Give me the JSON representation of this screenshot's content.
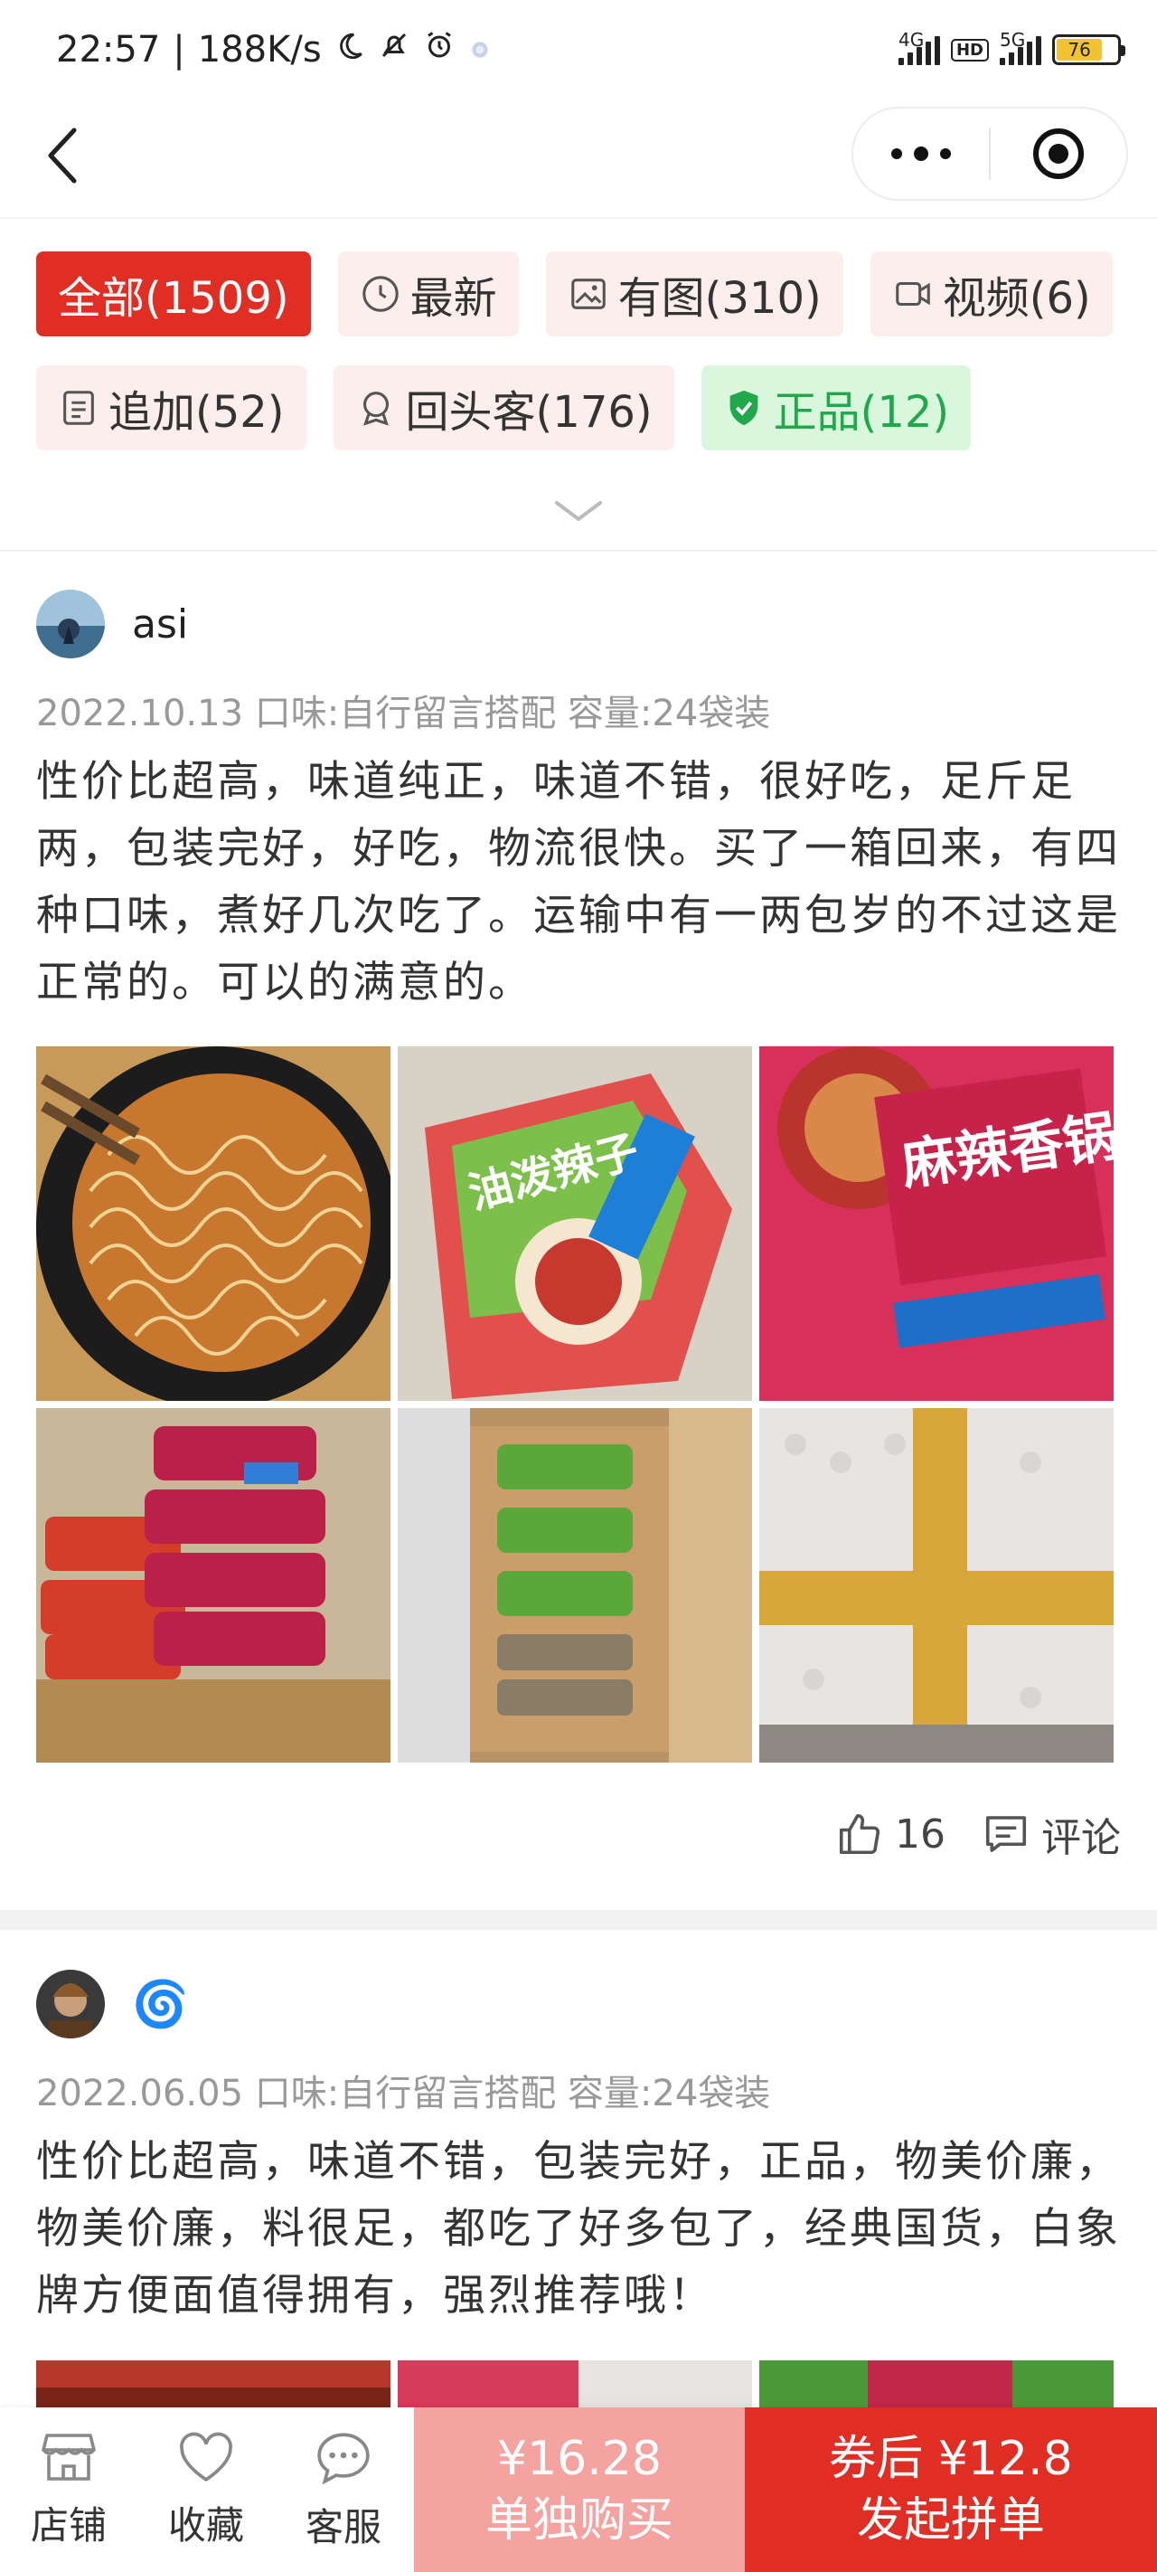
{
  "status_bar": {
    "time": "22:57",
    "speed": "188K/s",
    "net1": "4G",
    "hd": "HD",
    "net2": "5G",
    "battery": "76",
    "battery_level": 0.76
  },
  "filters": [
    {
      "label": "全部(1509)",
      "icon": "none"
    },
    {
      "label": "最新",
      "icon": "clock-icon"
    },
    {
      "label": "有图(310)",
      "icon": "image-icon"
    },
    {
      "label": "视频(6)",
      "icon": "video-icon"
    },
    {
      "label": "追加(52)",
      "icon": "document-icon"
    },
    {
      "label": "回头客(176)",
      "icon": "badge-icon"
    },
    {
      "label": "正品(12)",
      "icon": "shield-check-icon"
    }
  ],
  "reviews": [
    {
      "username": "asi",
      "meta": "2022.10.13   口味:自行留言搭配  容量:24袋装",
      "text": "性价比超高，味道纯正，味道不错，很好吃，足斤足两，包装完好，好吃，物流很快。买了一箱回来，有四种口味，煮好几次吃了。运输中有一两包岁的不过这是正常的。可以的满意的。",
      "likes": "16",
      "comment_label": "评论",
      "images": [
        "noodles-bowl-photo",
        "pickled-cabbage-noodle-pack-photo",
        "spicy-beef-noodle-pack-photo",
        "noodle-packs-stack-photo",
        "noodle-packs-in-box-photo",
        "taped-bubble-wrap-box-photo"
      ]
    },
    {
      "username": "🌀",
      "meta": "2022.06.05   口味:自行留言搭配  容量:24袋装",
      "text": "性价比超高，味道不错，包装完好，正品，物美价廉，物美价廉，料很足，都吃了好多包了，经典国货，白象牌方便面值得拥有，强烈推荐哦！"
    }
  ],
  "bottom_bar": {
    "shop": "店铺",
    "favorite": "收藏",
    "service": "客服",
    "single_price": "¥16.28",
    "single_label": "单独购买",
    "group_price": "券后 ¥12.8",
    "group_label": "发起拼单"
  },
  "colors": {
    "accent": "#e02e24",
    "single_buy": "#f4a3a0",
    "genuine_green": "#20a84a"
  }
}
